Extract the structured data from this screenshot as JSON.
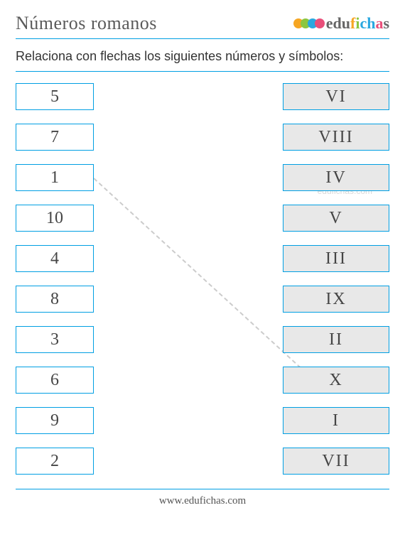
{
  "header": {
    "title": "Números romanos",
    "logo_text": "edufichas"
  },
  "instruction": "Relaciona con flechas los siguientes números y símbolos:",
  "watermark": "edufichas.com",
  "left_numbers": [
    "5",
    "7",
    "1",
    "10",
    "4",
    "8",
    "3",
    "6",
    "9",
    "2"
  ],
  "right_romans": [
    "VI",
    "VIII",
    "IV",
    "V",
    "III",
    "IX",
    "II",
    "X",
    "I",
    "VII"
  ],
  "footer": "www.edufichas.com"
}
